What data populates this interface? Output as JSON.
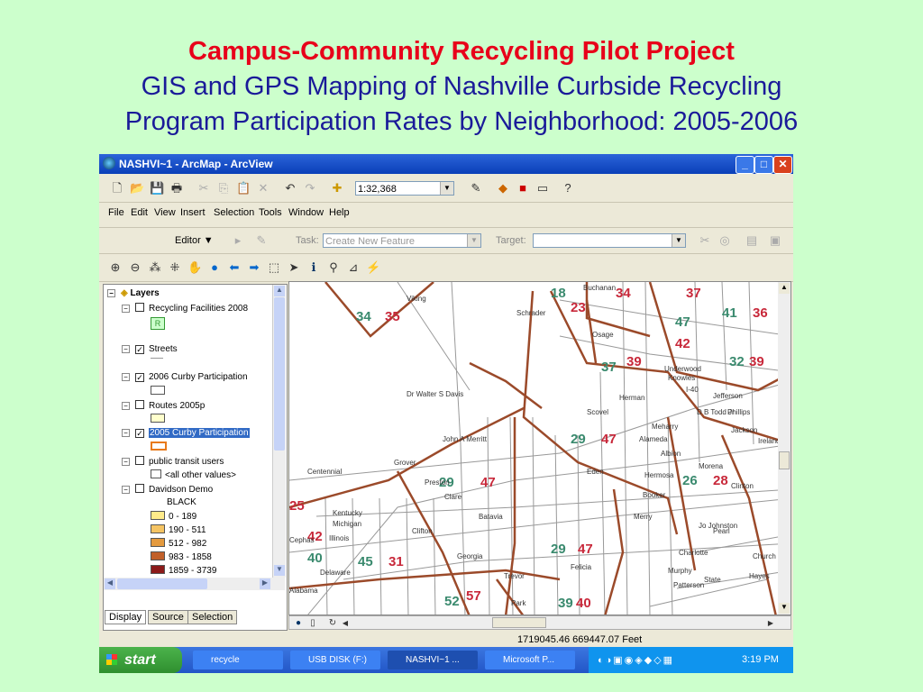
{
  "slide": {
    "title": "Campus-Community Recycling Pilot Project",
    "subtitle_line1": "GIS and GPS Mapping of Nashville Curbside Recycling",
    "subtitle_line2": "Program Participation Rates by Neighborhood: 2005-2006"
  },
  "window": {
    "title": "NASHVI~1 - ArcMap - ArcView",
    "minimize": "_",
    "maximize": "□",
    "close": "✕"
  },
  "toolbar": {
    "scale": "1:32,368"
  },
  "menubar": [
    "File",
    "Edit",
    "View",
    "Insert",
    "Selection",
    "Tools",
    "Window",
    "Help"
  ],
  "editor": {
    "editor_label": "Editor",
    "task_label": "Task:",
    "task_value": "Create New Feature",
    "target_label": "Target:",
    "target_value": ""
  },
  "toc": {
    "root": "Layers",
    "layers": [
      {
        "name": "Recycling Facilities 2008",
        "checked": false,
        "symbol": "R"
      },
      {
        "name": "Streets",
        "checked": true
      },
      {
        "name": "2006 Curby Participation",
        "checked": true
      },
      {
        "name": "Routes 2005p",
        "checked": false
      },
      {
        "name": "2005 Curby Participation",
        "checked": true,
        "selected": true
      },
      {
        "name": "public transit users",
        "checked": false,
        "sub": "<all other values>"
      },
      {
        "name": "Davidson Demo",
        "checked": false,
        "sub": "BLACK"
      }
    ],
    "legend": [
      {
        "label": "0 - 189",
        "color": "#ffeb8a"
      },
      {
        "label": "190 - 511",
        "color": "#f5c463"
      },
      {
        "label": "512 - 982",
        "color": "#e49a3e"
      },
      {
        "label": "983 - 1858",
        "color": "#c1602a"
      },
      {
        "label": "1859 - 3739",
        "color": "#8b1a1a"
      }
    ],
    "tabs": [
      "Display",
      "Source",
      "Selection"
    ]
  },
  "map": {
    "numbers": [
      {
        "t": "18",
        "c": "g"
      },
      {
        "t": "34",
        "c": "r"
      },
      {
        "t": "37",
        "c": "r"
      },
      {
        "t": "23",
        "c": "r"
      },
      {
        "t": "34",
        "c": "g"
      },
      {
        "t": "35",
        "c": "r"
      },
      {
        "t": "47",
        "c": "g"
      },
      {
        "t": "41",
        "c": "g"
      },
      {
        "t": "36",
        "c": "r"
      },
      {
        "t": "42",
        "c": "r"
      },
      {
        "t": "37",
        "c": "g"
      },
      {
        "t": "39",
        "c": "r"
      },
      {
        "t": "32",
        "c": "g"
      },
      {
        "t": "39",
        "c": "r"
      },
      {
        "t": "29",
        "c": "g"
      },
      {
        "t": "47",
        "c": "r"
      },
      {
        "t": "29",
        "c": "g"
      },
      {
        "t": "47",
        "c": "r"
      },
      {
        "t": "26",
        "c": "g"
      },
      {
        "t": "28",
        "c": "r"
      },
      {
        "t": "25",
        "c": "r"
      },
      {
        "t": "42",
        "c": "r"
      },
      {
        "t": "40",
        "c": "g"
      },
      {
        "t": "45",
        "c": "g"
      },
      {
        "t": "31",
        "c": "r"
      },
      {
        "t": "29",
        "c": "g"
      },
      {
        "t": "47",
        "c": "r"
      },
      {
        "t": "52",
        "c": "g"
      },
      {
        "t": "57",
        "c": "r"
      },
      {
        "t": "39",
        "c": "g"
      },
      {
        "t": "40",
        "c": "r"
      }
    ],
    "streets": [
      "Buchanan",
      "Viking",
      "Schrader",
      "Osage",
      "Underwood",
      "Knowles",
      "Jefferson",
      "Herman",
      "Scovel",
      "Meharry",
      "Alameda",
      "Albion",
      "Eden",
      "Hermosa",
      "Booker",
      "Merry",
      "John A Merritt",
      "Centennial",
      "Kentucky",
      "Michigan",
      "Illinois",
      "Delaware",
      "Alabama",
      "Clifton",
      "Clare",
      "Batavia",
      "Georgia",
      "Felicia",
      "Charlotte",
      "Jo Johnston",
      "Pearl",
      "Clinton",
      "Murphy",
      "Patterson",
      "State",
      "Church",
      "Hayes",
      "Park",
      "Trevor",
      "Phillips",
      "Jackson",
      "Ireland",
      "Morena",
      "I-40",
      "D B Todd Jr",
      "Dr Walter S Davis",
      "Grover",
      "Preston",
      "Cephas"
    ]
  },
  "status": {
    "coordinates": "1719045.46  669447.07 Feet"
  },
  "taskbar": {
    "start": "start",
    "items": [
      "recycle",
      "USB DISK (F:)",
      "NASHVI~1 ...",
      "Microsoft P..."
    ],
    "clock": "3:19 PM"
  }
}
